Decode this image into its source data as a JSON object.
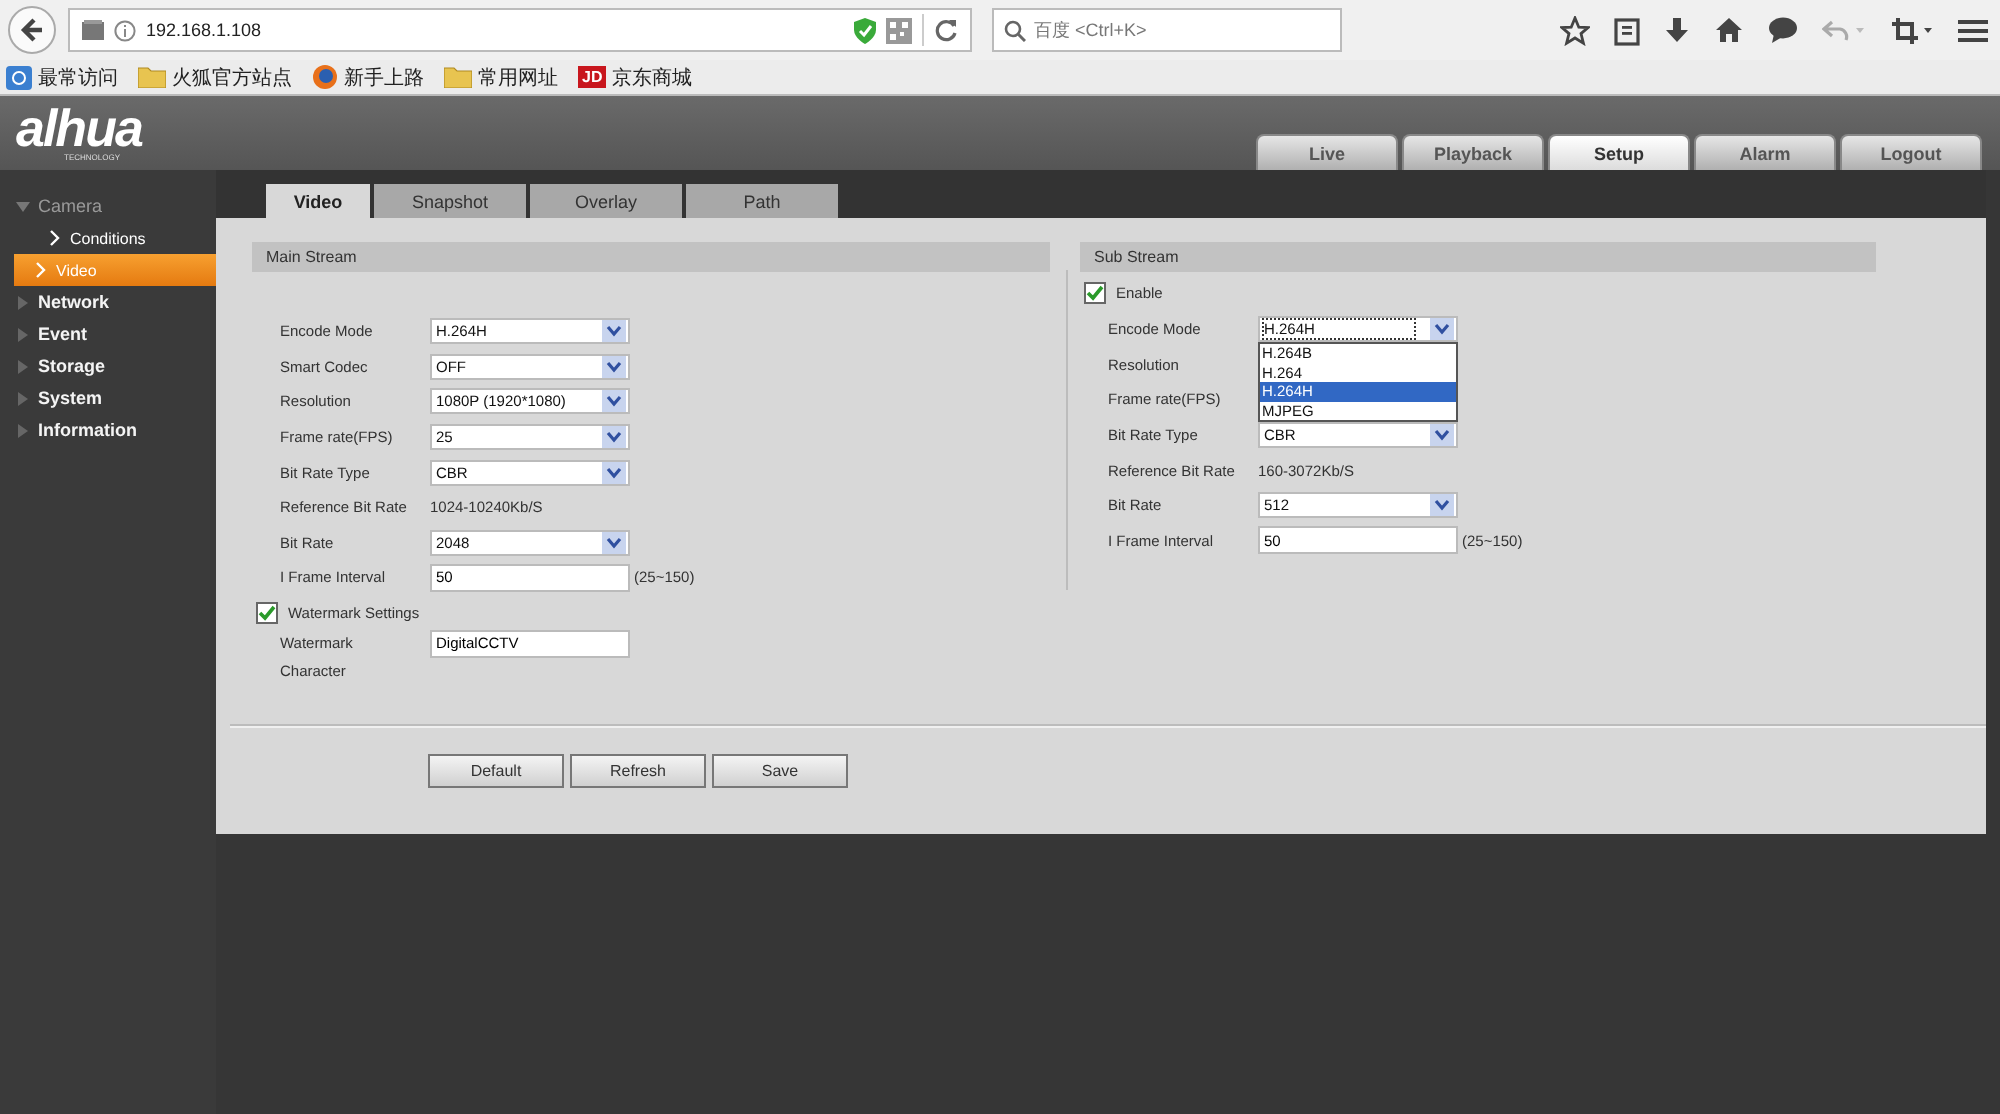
{
  "browser": {
    "url": "192.168.1.108",
    "search_placeholder": "百度 <Ctrl+K>",
    "bookmarks": [
      {
        "label": "最常访问",
        "kind": "globe"
      },
      {
        "label": "火狐官方站点",
        "kind": "folder"
      },
      {
        "label": "新手上路",
        "kind": "firefox"
      },
      {
        "label": "常用网址",
        "kind": "folder"
      },
      {
        "label": "京东商城",
        "kind": "jd",
        "badge": "JD"
      }
    ]
  },
  "header": {
    "logo": "alhua",
    "logo_sub": "TECHNOLOGY",
    "nav": [
      {
        "label": "Live",
        "selected": false
      },
      {
        "label": "Playback",
        "selected": false
      },
      {
        "label": "Setup",
        "selected": true
      },
      {
        "label": "Alarm",
        "selected": false
      },
      {
        "label": "Logout",
        "selected": false
      }
    ]
  },
  "sidebar": [
    {
      "label": "Camera",
      "expanded": true,
      "children": [
        {
          "label": "Conditions",
          "selected": false
        },
        {
          "label": "Video",
          "selected": true
        }
      ]
    },
    {
      "label": "Network",
      "expanded": false
    },
    {
      "label": "Event",
      "expanded": false
    },
    {
      "label": "Storage",
      "expanded": false
    },
    {
      "label": "System",
      "expanded": false
    },
    {
      "label": "Information",
      "expanded": false
    }
  ],
  "tabs": [
    {
      "label": "Video",
      "selected": true
    },
    {
      "label": "Snapshot",
      "selected": false
    },
    {
      "label": "Overlay",
      "selected": false
    },
    {
      "label": "Path",
      "selected": false
    }
  ],
  "main_stream": {
    "title": "Main Stream",
    "fields": [
      {
        "label": "Encode Mode",
        "kind": "select",
        "value": "H.264H"
      },
      {
        "label": "Smart Codec",
        "kind": "select",
        "value": "OFF"
      },
      {
        "label": "Resolution",
        "kind": "select",
        "value": "1080P (1920*1080)"
      },
      {
        "label": "Frame rate(FPS)",
        "kind": "select",
        "value": "25"
      },
      {
        "label": "Bit Rate Type",
        "kind": "select",
        "value": "CBR"
      },
      {
        "label": "Reference Bit Rate",
        "kind": "text",
        "value": "1024-10240Kb/S"
      },
      {
        "label": "Bit Rate",
        "kind": "select",
        "value": "2048"
      },
      {
        "label": "I Frame Interval",
        "kind": "input",
        "value": "50",
        "hint": "(25~150)"
      }
    ],
    "watermark": {
      "label": "Watermark Settings",
      "checked": true,
      "field_label": "Watermark Character",
      "value": "DigitalCCTV"
    }
  },
  "sub_stream": {
    "title": "Sub Stream",
    "enable": {
      "label": "Enable",
      "checked": true
    },
    "fields": [
      {
        "label": "Encode Mode",
        "kind": "select",
        "value": "H.264H",
        "focused": true
      },
      {
        "label": "Resolution",
        "kind": "covered"
      },
      {
        "label": "Frame rate(FPS)",
        "kind": "covered"
      },
      {
        "label": "Bit Rate Type",
        "kind": "select",
        "value": "CBR"
      },
      {
        "label": "Reference Bit Rate",
        "kind": "text",
        "value": "160-3072Kb/S"
      },
      {
        "label": "Bit Rate",
        "kind": "select",
        "value": "512"
      },
      {
        "label": "I Frame Interval",
        "kind": "input",
        "value": "50",
        "hint": "(25~150)"
      }
    ],
    "dropdown": [
      {
        "label": "H.264B",
        "selected": false
      },
      {
        "label": "H.264",
        "selected": false
      },
      {
        "label": "H.264H",
        "selected": true
      },
      {
        "label": "MJPEG",
        "selected": false
      }
    ]
  },
  "buttons": [
    "Default",
    "Refresh",
    "Save"
  ]
}
